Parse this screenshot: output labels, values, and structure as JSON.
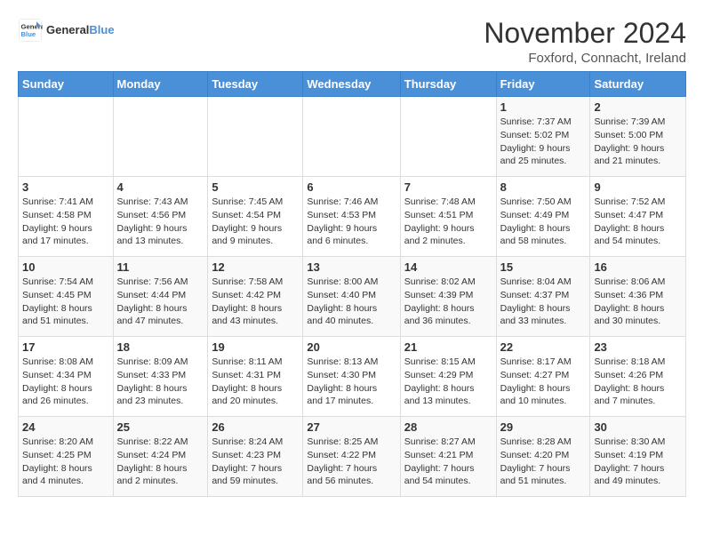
{
  "logo": {
    "text_general": "General",
    "text_blue": "Blue"
  },
  "title": "November 2024",
  "subtitle": "Foxford, Connacht, Ireland",
  "weekdays": [
    "Sunday",
    "Monday",
    "Tuesday",
    "Wednesday",
    "Thursday",
    "Friday",
    "Saturday"
  ],
  "weeks": [
    [
      {
        "day": "",
        "info": ""
      },
      {
        "day": "",
        "info": ""
      },
      {
        "day": "",
        "info": ""
      },
      {
        "day": "",
        "info": ""
      },
      {
        "day": "",
        "info": ""
      },
      {
        "day": "1",
        "info": "Sunrise: 7:37 AM\nSunset: 5:02 PM\nDaylight: 9 hours\nand 25 minutes."
      },
      {
        "day": "2",
        "info": "Sunrise: 7:39 AM\nSunset: 5:00 PM\nDaylight: 9 hours\nand 21 minutes."
      }
    ],
    [
      {
        "day": "3",
        "info": "Sunrise: 7:41 AM\nSunset: 4:58 PM\nDaylight: 9 hours\nand 17 minutes."
      },
      {
        "day": "4",
        "info": "Sunrise: 7:43 AM\nSunset: 4:56 PM\nDaylight: 9 hours\nand 13 minutes."
      },
      {
        "day": "5",
        "info": "Sunrise: 7:45 AM\nSunset: 4:54 PM\nDaylight: 9 hours\nand 9 minutes."
      },
      {
        "day": "6",
        "info": "Sunrise: 7:46 AM\nSunset: 4:53 PM\nDaylight: 9 hours\nand 6 minutes."
      },
      {
        "day": "7",
        "info": "Sunrise: 7:48 AM\nSunset: 4:51 PM\nDaylight: 9 hours\nand 2 minutes."
      },
      {
        "day": "8",
        "info": "Sunrise: 7:50 AM\nSunset: 4:49 PM\nDaylight: 8 hours\nand 58 minutes."
      },
      {
        "day": "9",
        "info": "Sunrise: 7:52 AM\nSunset: 4:47 PM\nDaylight: 8 hours\nand 54 minutes."
      }
    ],
    [
      {
        "day": "10",
        "info": "Sunrise: 7:54 AM\nSunset: 4:45 PM\nDaylight: 8 hours\nand 51 minutes."
      },
      {
        "day": "11",
        "info": "Sunrise: 7:56 AM\nSunset: 4:44 PM\nDaylight: 8 hours\nand 47 minutes."
      },
      {
        "day": "12",
        "info": "Sunrise: 7:58 AM\nSunset: 4:42 PM\nDaylight: 8 hours\nand 43 minutes."
      },
      {
        "day": "13",
        "info": "Sunrise: 8:00 AM\nSunset: 4:40 PM\nDaylight: 8 hours\nand 40 minutes."
      },
      {
        "day": "14",
        "info": "Sunrise: 8:02 AM\nSunset: 4:39 PM\nDaylight: 8 hours\nand 36 minutes."
      },
      {
        "day": "15",
        "info": "Sunrise: 8:04 AM\nSunset: 4:37 PM\nDaylight: 8 hours\nand 33 minutes."
      },
      {
        "day": "16",
        "info": "Sunrise: 8:06 AM\nSunset: 4:36 PM\nDaylight: 8 hours\nand 30 minutes."
      }
    ],
    [
      {
        "day": "17",
        "info": "Sunrise: 8:08 AM\nSunset: 4:34 PM\nDaylight: 8 hours\nand 26 minutes."
      },
      {
        "day": "18",
        "info": "Sunrise: 8:09 AM\nSunset: 4:33 PM\nDaylight: 8 hours\nand 23 minutes."
      },
      {
        "day": "19",
        "info": "Sunrise: 8:11 AM\nSunset: 4:31 PM\nDaylight: 8 hours\nand 20 minutes."
      },
      {
        "day": "20",
        "info": "Sunrise: 8:13 AM\nSunset: 4:30 PM\nDaylight: 8 hours\nand 17 minutes."
      },
      {
        "day": "21",
        "info": "Sunrise: 8:15 AM\nSunset: 4:29 PM\nDaylight: 8 hours\nand 13 minutes."
      },
      {
        "day": "22",
        "info": "Sunrise: 8:17 AM\nSunset: 4:27 PM\nDaylight: 8 hours\nand 10 minutes."
      },
      {
        "day": "23",
        "info": "Sunrise: 8:18 AM\nSunset: 4:26 PM\nDaylight: 8 hours\nand 7 minutes."
      }
    ],
    [
      {
        "day": "24",
        "info": "Sunrise: 8:20 AM\nSunset: 4:25 PM\nDaylight: 8 hours\nand 4 minutes."
      },
      {
        "day": "25",
        "info": "Sunrise: 8:22 AM\nSunset: 4:24 PM\nDaylight: 8 hours\nand 2 minutes."
      },
      {
        "day": "26",
        "info": "Sunrise: 8:24 AM\nSunset: 4:23 PM\nDaylight: 7 hours\nand 59 minutes."
      },
      {
        "day": "27",
        "info": "Sunrise: 8:25 AM\nSunset: 4:22 PM\nDaylight: 7 hours\nand 56 minutes."
      },
      {
        "day": "28",
        "info": "Sunrise: 8:27 AM\nSunset: 4:21 PM\nDaylight: 7 hours\nand 54 minutes."
      },
      {
        "day": "29",
        "info": "Sunrise: 8:28 AM\nSunset: 4:20 PM\nDaylight: 7 hours\nand 51 minutes."
      },
      {
        "day": "30",
        "info": "Sunrise: 8:30 AM\nSunset: 4:19 PM\nDaylight: 7 hours\nand 49 minutes."
      }
    ]
  ]
}
